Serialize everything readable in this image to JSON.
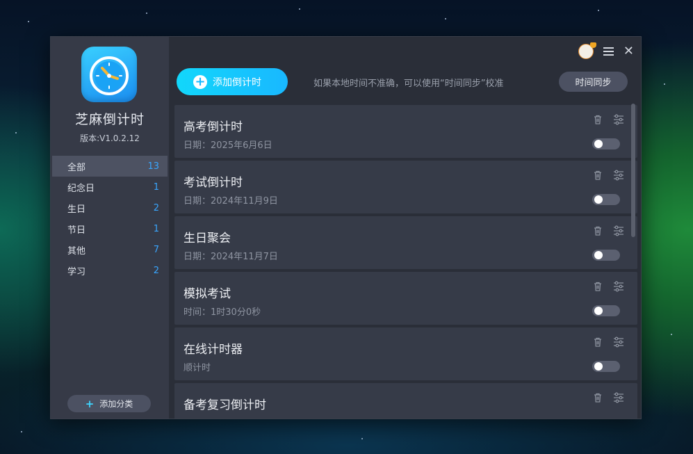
{
  "app": {
    "title": "芝麻倒计时",
    "version": "版本:V1.0.2.12"
  },
  "categories": [
    {
      "label": "全部",
      "count": "13",
      "active": true
    },
    {
      "label": "纪念日",
      "count": "1"
    },
    {
      "label": "生日",
      "count": "2"
    },
    {
      "label": "节日",
      "count": "1"
    },
    {
      "label": "其他",
      "count": "7"
    },
    {
      "label": "学习",
      "count": "2"
    }
  ],
  "sidebar": {
    "add_category_label": "添加分类"
  },
  "toolbar": {
    "add_countdown_label": "添加倒计时",
    "sync_hint": "如果本地时间不准确，可以使用“时间同步”校准",
    "sync_button_label": "时间同步"
  },
  "items": [
    {
      "title": "高考倒计时",
      "sub": "日期：2025年6月6日",
      "enabled": false
    },
    {
      "title": "考试倒计时",
      "sub": "日期：2024年11月9日",
      "enabled": false
    },
    {
      "title": "生日聚会",
      "sub": "日期：2024年11月7日",
      "enabled": false
    },
    {
      "title": "模拟考试",
      "sub": "时间：1时30分0秒",
      "enabled": false
    },
    {
      "title": "在线计时器",
      "sub": "顺计时",
      "enabled": false
    },
    {
      "title": "备考复习倒计时",
      "sub": "",
      "enabled": false
    }
  ],
  "colors": {
    "accent": "#19b8ff",
    "count": "#39a6ff",
    "sidebar_bg": "#363a47",
    "main_bg": "#2a2e38",
    "card_bg": "#363b48"
  },
  "icons": [
    "clock-logo-icon",
    "avatar-icon",
    "menu-icon",
    "close-icon",
    "plus-icon",
    "trash-icon",
    "sliders-icon"
  ]
}
